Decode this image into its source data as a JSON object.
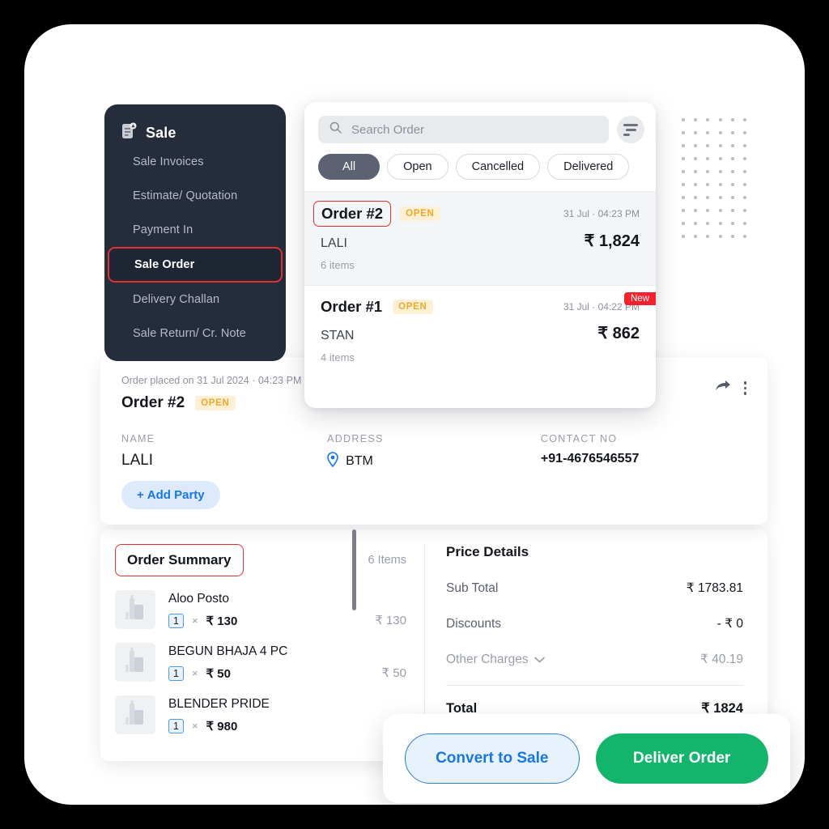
{
  "sidebar": {
    "header_title": "Sale",
    "header_icon": "document-badge-icon",
    "items": [
      {
        "label": "Sale Invoices",
        "active": false
      },
      {
        "label": "Estimate/ Quotation",
        "active": false
      },
      {
        "label": "Payment In",
        "active": false
      },
      {
        "label": "Sale Order",
        "active": true
      },
      {
        "label": "Delivery Challan",
        "active": false
      },
      {
        "label": "Sale Return/ Cr. Note",
        "active": false
      }
    ]
  },
  "order_panel": {
    "search": {
      "placeholder": "Search Order",
      "value": "",
      "icon": "search-icon"
    },
    "filter_icon": "filter-icon",
    "chips": [
      {
        "label": "All",
        "selected": true
      },
      {
        "label": "Open",
        "selected": false
      },
      {
        "label": "Cancelled",
        "selected": false
      },
      {
        "label": "Delivered",
        "selected": false
      }
    ],
    "orders": [
      {
        "id": "Order #2",
        "status": "OPEN",
        "date": "31 Jul · 04:23 PM",
        "party": "LALI",
        "amount": "₹ 1,824",
        "items": "6 items",
        "new_badge": "",
        "selected": true
      },
      {
        "id": "Order #1",
        "status": "OPEN",
        "date": "31 Jul · 04:22 PM",
        "party": "STAN",
        "amount": "₹ 862",
        "items": "4 items",
        "new_badge": "New",
        "selected": false
      }
    ]
  },
  "detail": {
    "placed_text": "Order placed on 31 Jul 2024 · 04:23 PM",
    "order_id": "Order #2",
    "status": "OPEN",
    "share_icon": "share-icon",
    "more_icon": "more-vertical-icon",
    "name_label": "NAME",
    "name_value": "LALI",
    "add_party_label": "Add Party",
    "address_label": "ADDRESS",
    "address_value": "BTM",
    "address_icon": "location-pin-icon",
    "contact_label": "CONTACT NO",
    "contact_value": "+91-4676546557"
  },
  "summary": {
    "title": "Order Summary",
    "count": "6 Items",
    "items": [
      {
        "name": "Aloo Posto",
        "qty": "1",
        "unit_price": "₹ 130",
        "line_total": "₹ 130"
      },
      {
        "name": "BEGUN BHAJA 4 PC",
        "qty": "1",
        "unit_price": "₹ 50",
        "line_total": "₹ 50"
      },
      {
        "name": "BLENDER PRIDE",
        "qty": "1",
        "unit_price": "₹ 980",
        "line_total": "₹"
      }
    ]
  },
  "price_details": {
    "title": "Price Details",
    "rows": [
      {
        "label": "Sub Total",
        "value": "₹ 1783.81",
        "muted": false
      },
      {
        "label": "Discounts",
        "value": "- ₹ 0",
        "muted": false
      },
      {
        "label": "Other Charges",
        "value": "₹ 40.19",
        "muted": true,
        "chevron": true
      }
    ],
    "total_label": "Total",
    "total_value": "₹ 1824"
  },
  "actions": {
    "convert_label": "Convert to Sale",
    "deliver_label": "Deliver Order"
  },
  "colors": {
    "sidebar_bg": "#252c3b",
    "accent_red": "#e03131",
    "accent_blue": "#1877e0",
    "accent_green": "#13b46b",
    "status_orange": "#f0a92b",
    "badge_red": "#f4212e"
  }
}
